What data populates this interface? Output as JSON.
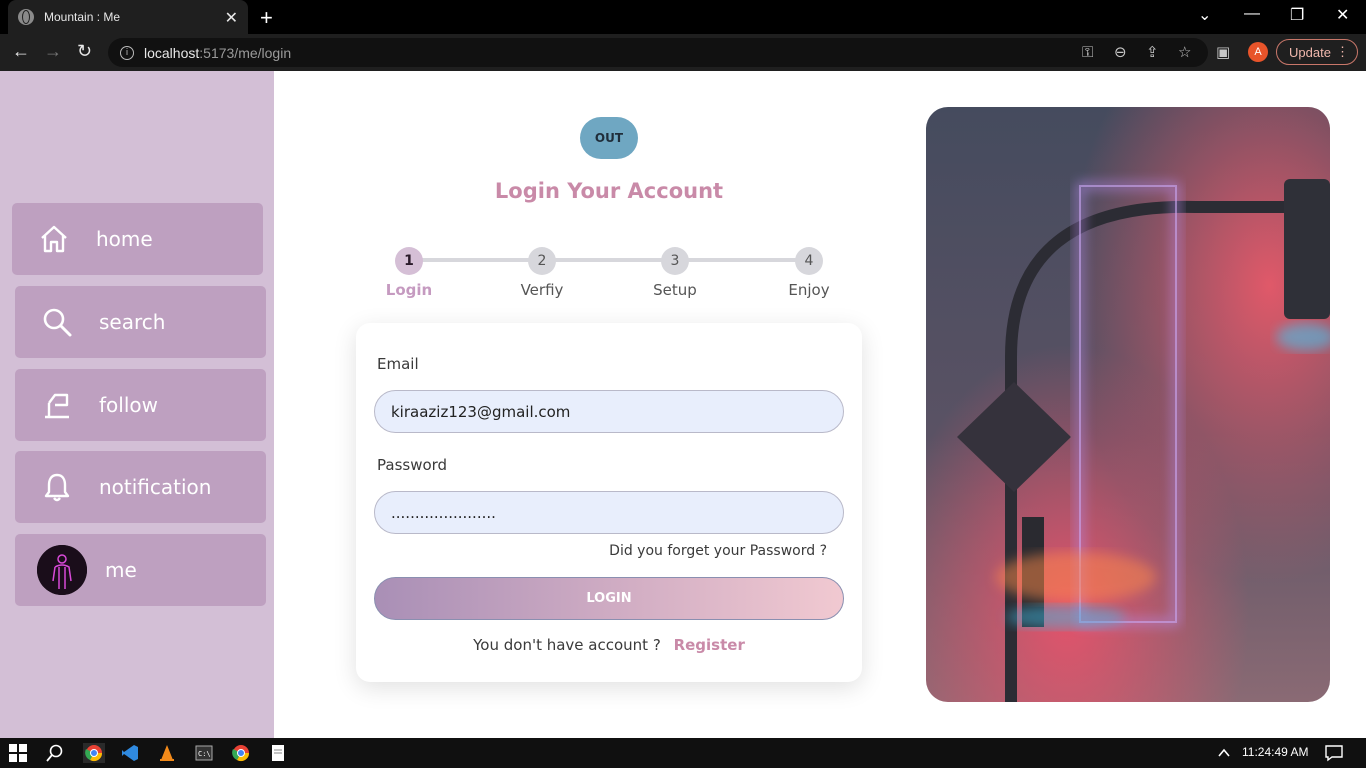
{
  "browser": {
    "tab_title": "Mountain : Me",
    "url_host": "localhost",
    "url_rest": ":5173/me/login",
    "profile_initial": "A",
    "update_label": "Update"
  },
  "sidebar": {
    "items": [
      {
        "label": "home",
        "icon": "home-icon"
      },
      {
        "label": "search",
        "icon": "search-icon"
      },
      {
        "label": "follow",
        "icon": "follow-icon"
      },
      {
        "label": "notification",
        "icon": "bell-icon"
      },
      {
        "label": "me",
        "icon": "avatar"
      }
    ],
    "bg_color": "#d3bfd6",
    "item_color": "#bea0c0"
  },
  "main": {
    "out_label": "OUT",
    "heading": "Login Your Account",
    "steps": [
      {
        "number": "1",
        "label": "Login",
        "active": true
      },
      {
        "number": "2",
        "label": "Verfiy",
        "active": false
      },
      {
        "number": "3",
        "label": "Setup",
        "active": false
      },
      {
        "number": "4",
        "label": "Enjoy",
        "active": false
      }
    ]
  },
  "form": {
    "email_label": "Email",
    "email_value": "kiraaziz123@gmail.com",
    "password_label": "Password",
    "password_value": "......................",
    "forgot_link": "Did you forget your Password ?",
    "login_label": "LOGIN",
    "no_account_text": "You don't have account ?",
    "register_label": "Register"
  },
  "taskbar": {
    "clock": "11:24:49 AM"
  },
  "colors": {
    "accent": "#c98aa8",
    "out_button": "#6fa7c2"
  }
}
